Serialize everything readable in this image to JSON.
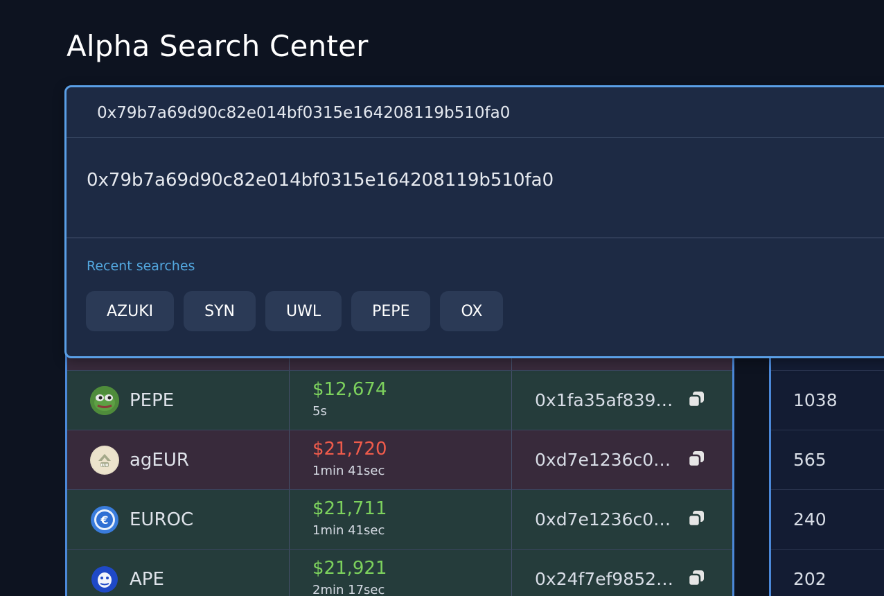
{
  "page": {
    "title": "Alpha Search Center"
  },
  "search": {
    "query": "0x79b7a69d90c82e014bf0315e164208119b510fa0",
    "result_address": "0x79b7a69d90c82e014bf0315e164208119b510fa0",
    "recent_label": "Recent searches",
    "recent_chips": [
      "AZUKI",
      "SYN",
      "UWL",
      "PEPE",
      "OX"
    ]
  },
  "colors": {
    "up": "#7dd25d",
    "down": "#ef5b4b",
    "accent": "#5a9fe6",
    "recent_label": "#53a8e0"
  },
  "rows": [
    {
      "token": "PEPE",
      "icon": "pepe-icon",
      "price": "$12,674",
      "direction": "up",
      "age": "5s",
      "address": "0x1fa35af8398...",
      "count": "1038"
    },
    {
      "token": "agEUR",
      "icon": "ageur-icon",
      "price": "$21,720",
      "direction": "down",
      "age": "1min 41sec",
      "address": "0xd7e1236c08...",
      "count": "565"
    },
    {
      "token": "EUROC",
      "icon": "euroc-icon",
      "price": "$21,711",
      "direction": "up",
      "age": "1min 41sec",
      "address": "0xd7e1236c08...",
      "count": "240"
    },
    {
      "token": "APE",
      "icon": "ape-icon",
      "price": "$21,921",
      "direction": "up",
      "age": "2min 17sec",
      "address": "0x24f7ef98522...",
      "count": "202"
    }
  ]
}
